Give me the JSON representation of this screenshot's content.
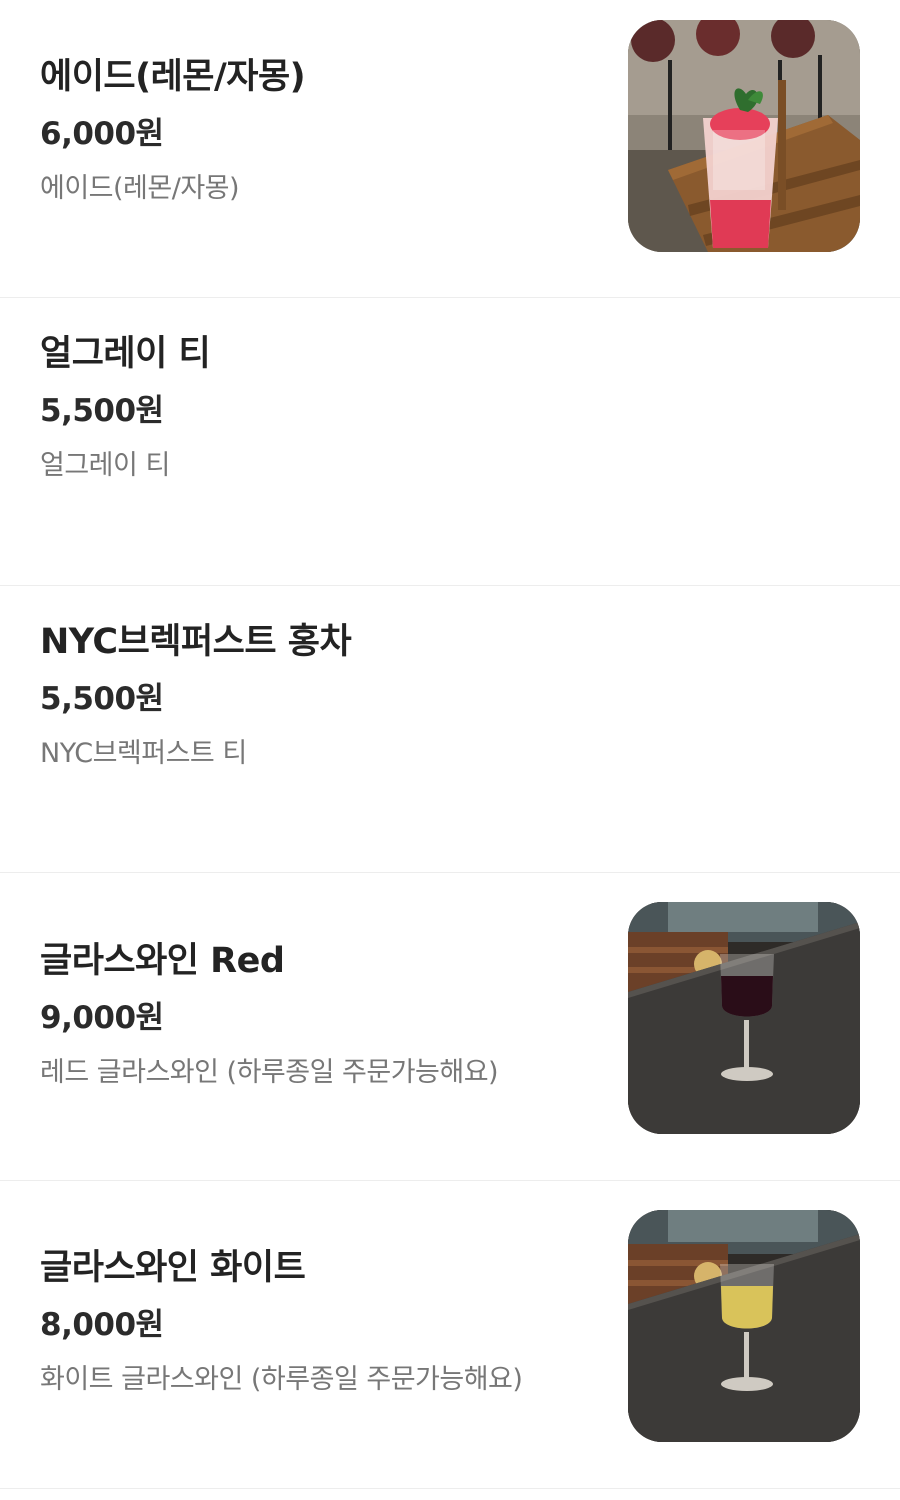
{
  "menu": {
    "items": [
      {
        "name": "에이드(레몬/자몽)",
        "price": "6,000원",
        "description": "에이드(레몬/자몽)",
        "has_image": true,
        "image_subject": "ade-glass"
      },
      {
        "name": "얼그레이 티",
        "price": "5,500원",
        "description": "얼그레이 티",
        "has_image": false
      },
      {
        "name": "NYC브렉퍼스트 홍차",
        "price": "5,500원",
        "description": "NYC브렉퍼스트 티",
        "has_image": false
      },
      {
        "name": "글라스와인 Red",
        "price": "9,000원",
        "description": "레드 글라스와인 (하루종일 주문가능해요)",
        "has_image": true,
        "image_subject": "red-wine-glass"
      },
      {
        "name": "글라스와인 화이트",
        "price": "8,000원",
        "description": "화이트 글라스와인 (하루종일 주문가능해요)",
        "has_image": true,
        "image_subject": "white-wine-glass"
      }
    ]
  },
  "colors": {
    "text_primary": "#232323",
    "text_secondary": "#777777",
    "divider": "#ededed",
    "red_wine": "#2a0d18",
    "white_wine": "#d9c35a"
  }
}
